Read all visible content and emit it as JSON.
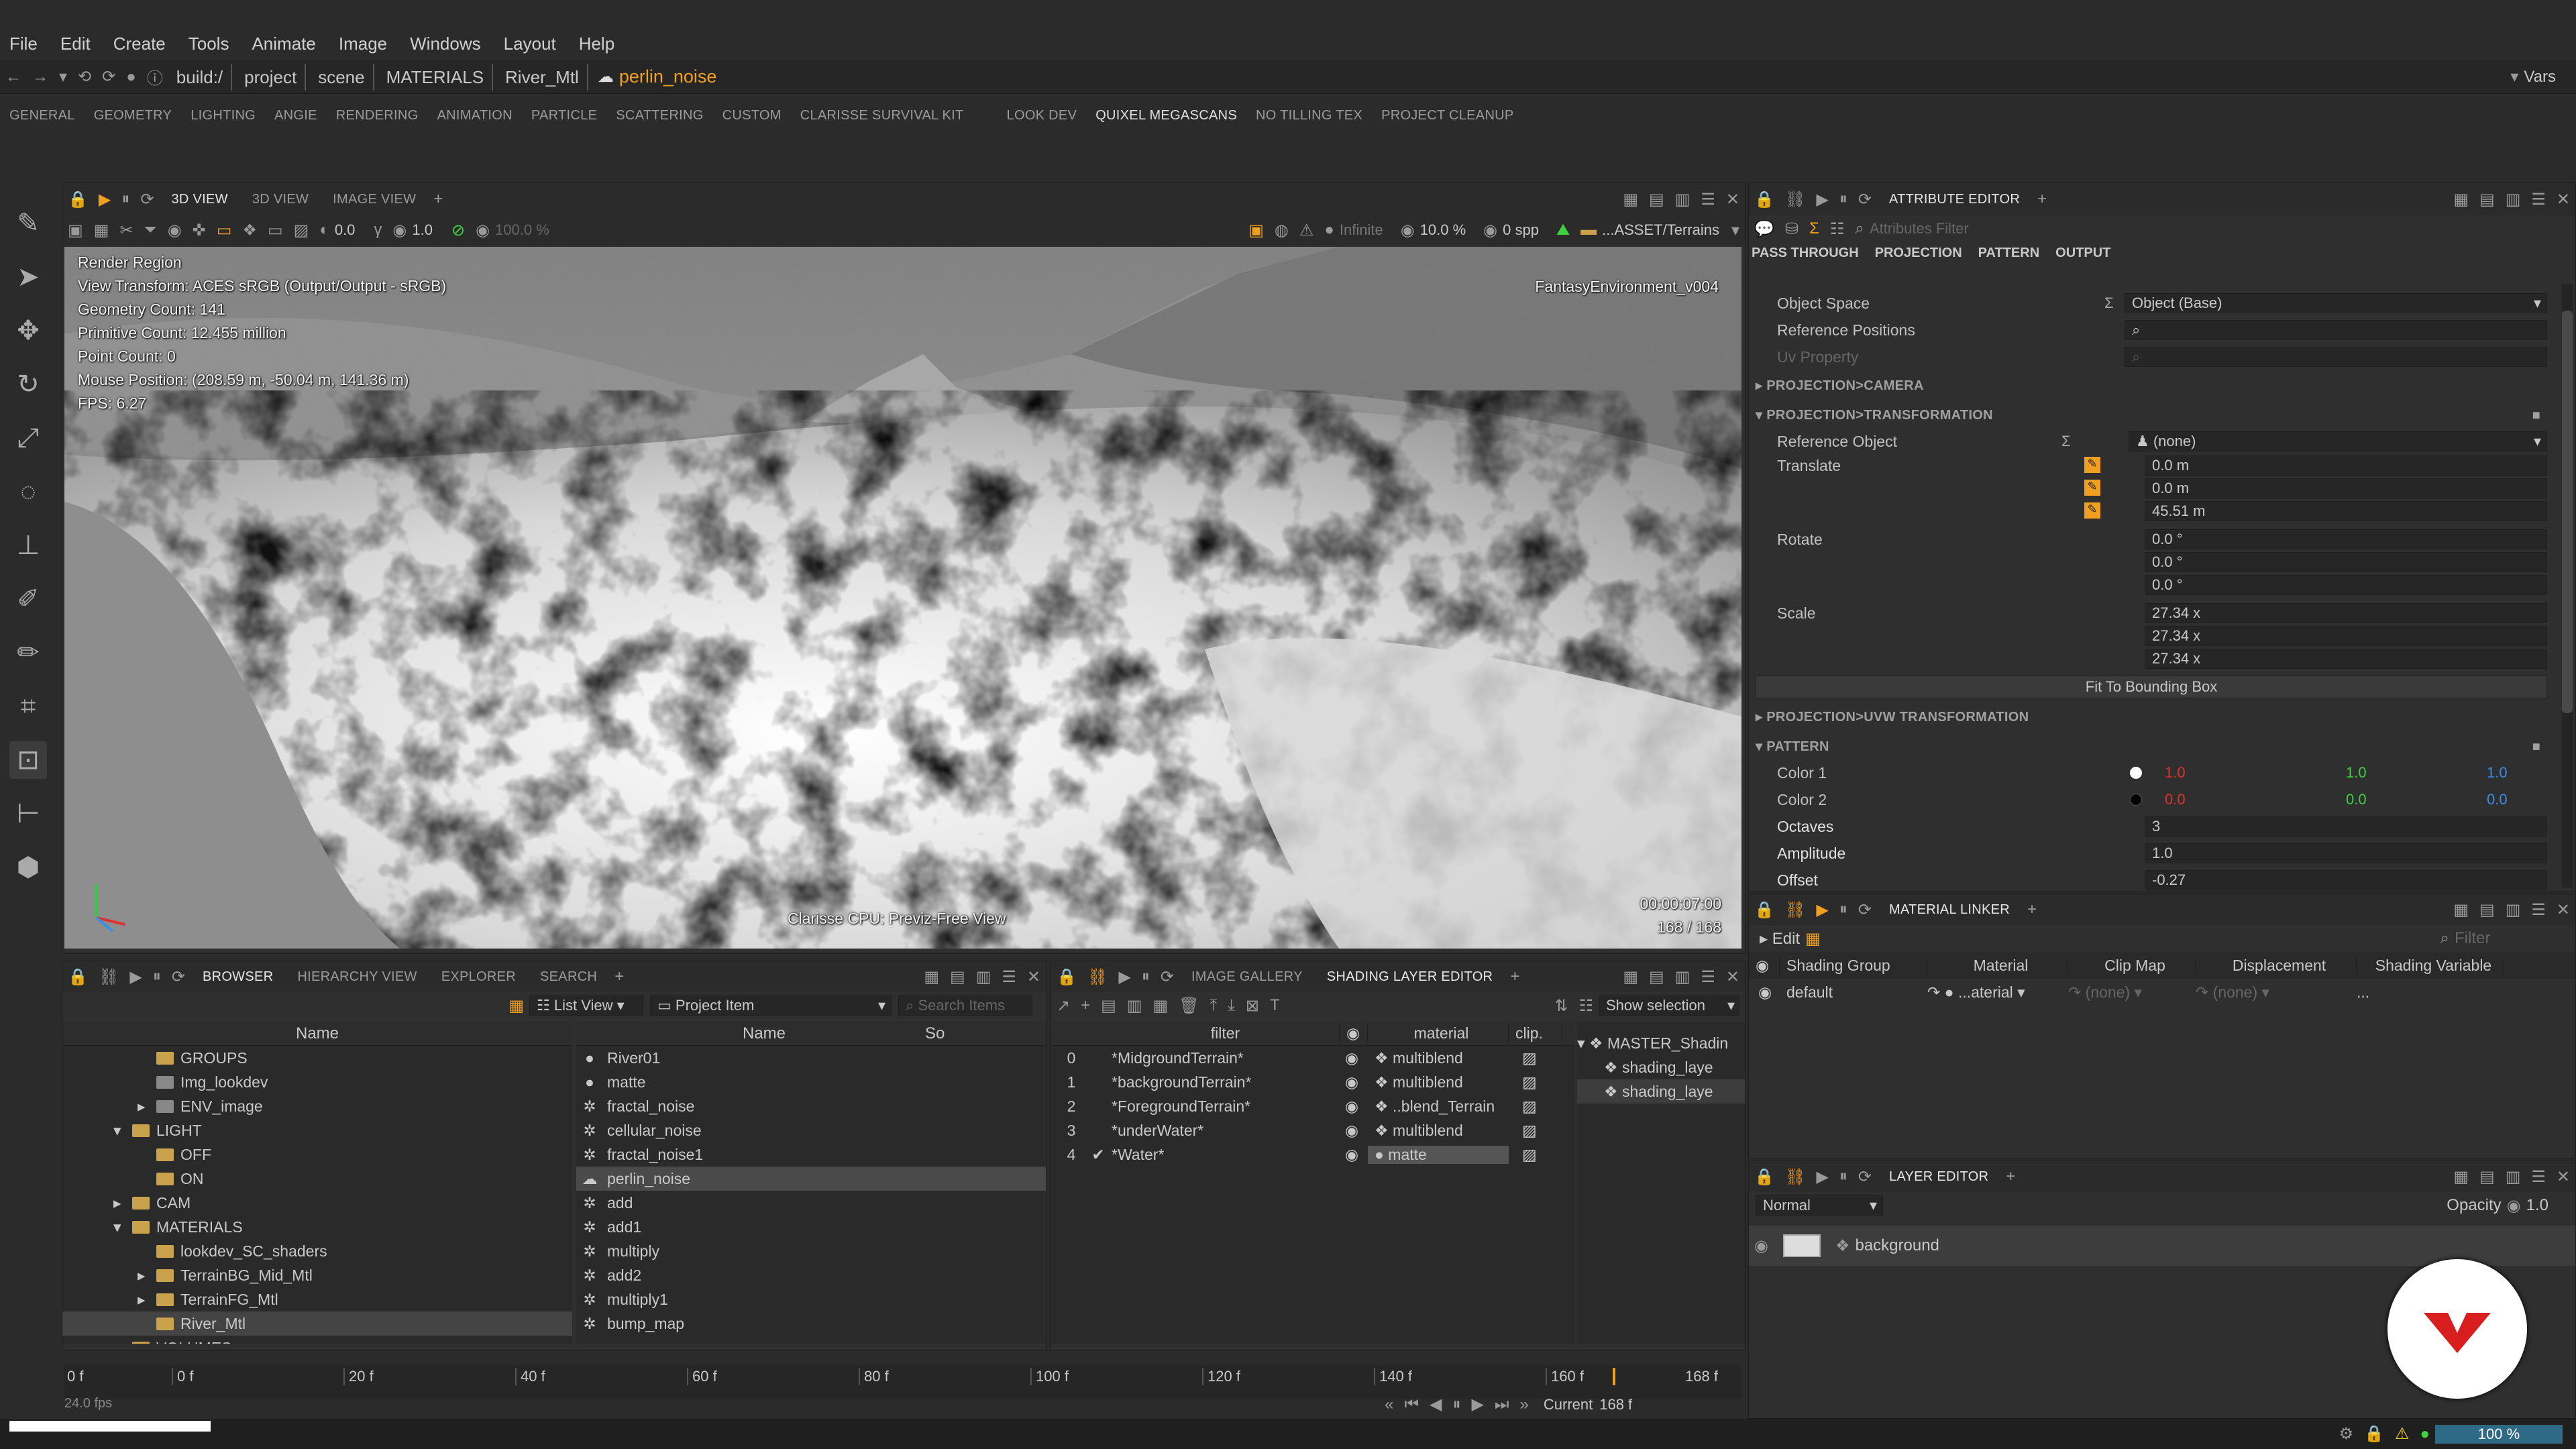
{
  "menu": [
    "File",
    "Edit",
    "Create",
    "Tools",
    "Animate",
    "Image",
    "Windows",
    "Layout",
    "Help"
  ],
  "address": {
    "crumbs": [
      "build:/",
      "project",
      "scene",
      "MATERIALS",
      "River_Mtl"
    ],
    "current": "perlin_noise",
    "vars": "Vars"
  },
  "shelf": {
    "tabs": [
      "GENERAL",
      "GEOMETRY",
      "LIGHTING",
      "ANGIE",
      "RENDERING",
      "ANIMATION",
      "PARTICLE",
      "SCATTERING",
      "CUSTOM",
      "CLARISSE SURVIVAL KIT",
      "LOOK DEV",
      "QUIXEL MEGASCANS",
      "NO TILLING TEX",
      "PROJECT CLEANUP"
    ],
    "active": "QUIXEL MEGASCANS",
    "logo": "m"
  },
  "viewport": {
    "tabs": [
      "3D VIEW",
      "3D VIEW",
      "IMAGE VIEW"
    ],
    "toolbar": {
      "val1": "0.0",
      "val2": "1.0",
      "val3": "100.0 %",
      "infinite": "Infinite",
      "pct": "10.0 %",
      "spp": "0 spp",
      "path": "...ASSET/Terrains"
    },
    "hud": [
      "Render Region",
      "View Transform: ACES sRGB (Output/Output - sRGB)",
      "Geometry Count: 141",
      "Primitive Count: 12.455 million",
      "Point Count: 0",
      "Mouse Position: (208.59 m, -50.04 m, 141.36 m)",
      "FPS: 6.27"
    ],
    "env_label": "FantasyEnvironment_v004",
    "renderer": "Clarisse CPU: Previz-Free View",
    "timecode": "00:00:07:00",
    "frames": "168 / 168"
  },
  "attr": {
    "tab": "ATTRIBUTE EDITOR",
    "filter_placeholder": "Attributes Filter",
    "subtabs": [
      "PASS THROUGH",
      "PROJECTION",
      "PATTERN",
      "OUTPUT"
    ],
    "object_space": {
      "label": "Object Space",
      "value": "Object (Base)"
    },
    "ref_positions": "Reference Positions",
    "uv_property": "Uv Property",
    "sec_camera": "PROJECTION>CAMERA",
    "sec_transform": "PROJECTION>TRANSFORMATION",
    "ref_object": {
      "label": "Reference Object",
      "value": "(none)"
    },
    "translate": {
      "label": "Translate",
      "values": [
        "0.0 m",
        "0.0 m",
        "45.51 m"
      ]
    },
    "rotate": {
      "label": "Rotate",
      "values": [
        "0.0 °",
        "0.0 °",
        "0.0 °"
      ]
    },
    "scale": {
      "label": "Scale",
      "values": [
        "27.34 x",
        "27.34 x",
        "27.34 x"
      ]
    },
    "fit_button": "Fit To Bounding Box",
    "sec_uvw": "PROJECTION>UVW TRANSFORMATION",
    "sec_pattern": "PATTERN",
    "color1": {
      "label": "Color 1",
      "r": "1.0",
      "g": "1.0",
      "b": "1.0"
    },
    "color2": {
      "label": "Color 2",
      "r": "0.0",
      "g": "0.0",
      "b": "0.0"
    },
    "octaves": {
      "label": "Octaves",
      "value": "3"
    },
    "amplitude": {
      "label": "Amplitude",
      "value": "1.0"
    },
    "offset": {
      "label": "Offset",
      "value": "-0.27"
    }
  },
  "linker": {
    "tab": "MATERIAL LINKER",
    "edit": "Edit",
    "filter": "Filter",
    "columns": [
      "Shading Group",
      "Material",
      "Clip Map",
      "Displacement",
      "Shading Variable"
    ],
    "row": {
      "group": "default",
      "material": "...aterial",
      "clip": "(none)",
      "disp": "(none)",
      "var": "..."
    }
  },
  "layer": {
    "tab": "LAYER EDITOR",
    "mode": "Normal",
    "opacity_label": "Opacity",
    "opacity": "1.0",
    "item": "background"
  },
  "browser": {
    "tabs": [
      "BROWSER",
      "HIERARCHY VIEW",
      "EXPLORER",
      "SEARCH"
    ],
    "list_view": "List View",
    "project_item": "Project Item",
    "search_placeholder": "Search Items",
    "col_name": "Name",
    "col_name2": "Name",
    "col_so": "So",
    "tree": [
      {
        "label": "GROUPS",
        "indent": 2,
        "type": "folder",
        "arrow": ""
      },
      {
        "label": "Img_lookdev",
        "indent": 2,
        "type": "img",
        "arrow": ""
      },
      {
        "label": "ENV_image",
        "indent": 2,
        "type": "img",
        "arrow": "▸"
      },
      {
        "label": "LIGHT",
        "indent": 1,
        "type": "folder",
        "arrow": "▾"
      },
      {
        "label": "OFF",
        "indent": 2,
        "type": "folder",
        "arrow": ""
      },
      {
        "label": "ON",
        "indent": 2,
        "type": "folder",
        "arrow": ""
      },
      {
        "label": "CAM",
        "indent": 1,
        "type": "folder",
        "arrow": "▸"
      },
      {
        "label": "MATERIALS",
        "indent": 1,
        "type": "folder",
        "arrow": "▾"
      },
      {
        "label": "lookdev_SC_shaders",
        "indent": 2,
        "type": "folder",
        "arrow": ""
      },
      {
        "label": "TerrainBG_Mid_Mtl",
        "indent": 2,
        "type": "folder",
        "arrow": "▸"
      },
      {
        "label": "TerrainFG_Mtl",
        "indent": 2,
        "type": "folder",
        "arrow": "▸"
      },
      {
        "label": "River_Mtl",
        "indent": 2,
        "type": "folder",
        "arrow": ""
      },
      {
        "label": "VOLUMES",
        "indent": 1,
        "type": "folder",
        "arrow": "▸"
      }
    ],
    "items": [
      {
        "label": "River01",
        "icon": "●"
      },
      {
        "label": "matte",
        "icon": "●"
      },
      {
        "label": "fractal_noise",
        "icon": "✲"
      },
      {
        "label": "cellular_noise",
        "icon": "✲"
      },
      {
        "label": "fractal_noise1",
        "icon": "✲"
      },
      {
        "label": "perlin_noise",
        "icon": "☁"
      },
      {
        "label": "add",
        "icon": "✲"
      },
      {
        "label": "add1",
        "icon": "✲"
      },
      {
        "label": "multiply",
        "icon": "✲"
      },
      {
        "label": "add2",
        "icon": "✲"
      },
      {
        "label": "multiply1",
        "icon": "✲"
      },
      {
        "label": "bump_map",
        "icon": "✲"
      }
    ]
  },
  "shading": {
    "tabs": [
      "IMAGE GALLERY",
      "SHADING LAYER EDITOR"
    ],
    "show_selection": "Show selection",
    "col_filter": "filter",
    "col_material": "material",
    "col_clip": "clip.",
    "rows": [
      {
        "idx": "0",
        "check": "",
        "filter": "*MidgroundTerrain*",
        "material": "multiblend"
      },
      {
        "idx": "1",
        "check": "",
        "filter": "*backgroundTerrain*",
        "material": "multiblend"
      },
      {
        "idx": "2",
        "check": "",
        "filter": "*ForegroundTerrain*",
        "material": "..blend_Terrain"
      },
      {
        "idx": "3",
        "check": "",
        "filter": "*underWater*",
        "material": "multiblend"
      },
      {
        "idx": "4",
        "check": "✔",
        "filter": "*Water*",
        "material": "matte"
      }
    ],
    "tree": [
      "MASTER_Shadin",
      "shading_laye",
      "shading_laye"
    ]
  },
  "timeline": {
    "start": "0 f",
    "ticks": [
      "0 f",
      "20 f",
      "40 f",
      "60 f",
      "80 f",
      "100 f",
      "120 f",
      "140 f",
      "160 f"
    ],
    "end": "168 f",
    "fps": "24.0 fps",
    "current_label": "Current",
    "current": "168 f"
  },
  "status": {
    "zoom": "100 %"
  },
  "colors": {
    "accent": "#f0a020",
    "red": "#e03030",
    "green": "#40d040",
    "blue": "#3a8ee6"
  }
}
